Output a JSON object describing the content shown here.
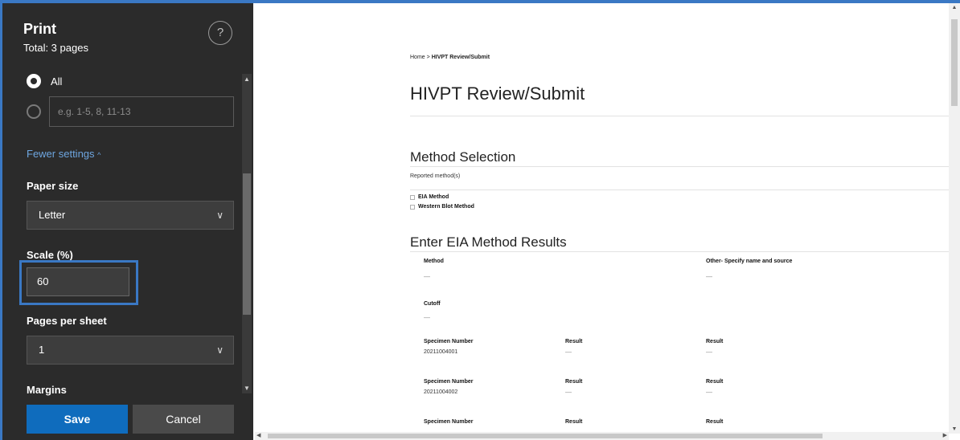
{
  "panel": {
    "title": "Print",
    "subtitle": "Total: 3 pages",
    "help_symbol": "?",
    "pages": {
      "all_label": "All",
      "custom_placeholder": "e.g. 1-5, 8, 11-13"
    },
    "fewer_settings_label": "Fewer settings",
    "fewer_settings_chevron": "^",
    "paper_size": {
      "label": "Paper size",
      "value": "Letter"
    },
    "scale": {
      "label": "Scale (%)",
      "value": "60"
    },
    "pages_per_sheet": {
      "label": "Pages per sheet",
      "value": "1"
    },
    "margins": {
      "label": "Margins"
    },
    "chevron": "∨",
    "save_label": "Save",
    "cancel_label": "Cancel",
    "highlight_color": "#3a78c4"
  },
  "preview": {
    "breadcrumb_home": "Home",
    "breadcrumb_sep": ">",
    "breadcrumb_current": "HIVPT Review/Submit",
    "title": "HIVPT Review/Submit",
    "method_selection": {
      "heading": "Method Selection",
      "reported_label": "Reported method(s)",
      "methods": [
        "EIA Method",
        "Western Blot Method"
      ]
    },
    "eia": {
      "heading": "Enter EIA Method Results",
      "method_label": "Method",
      "other_label": "Other- Specify name and source",
      "cutoff_label": "Cutoff",
      "empty_value": "—",
      "specimen_label": "Specimen Number",
      "result_label": "Result",
      "specimens": [
        "20211004001",
        "20211004002"
      ]
    }
  }
}
